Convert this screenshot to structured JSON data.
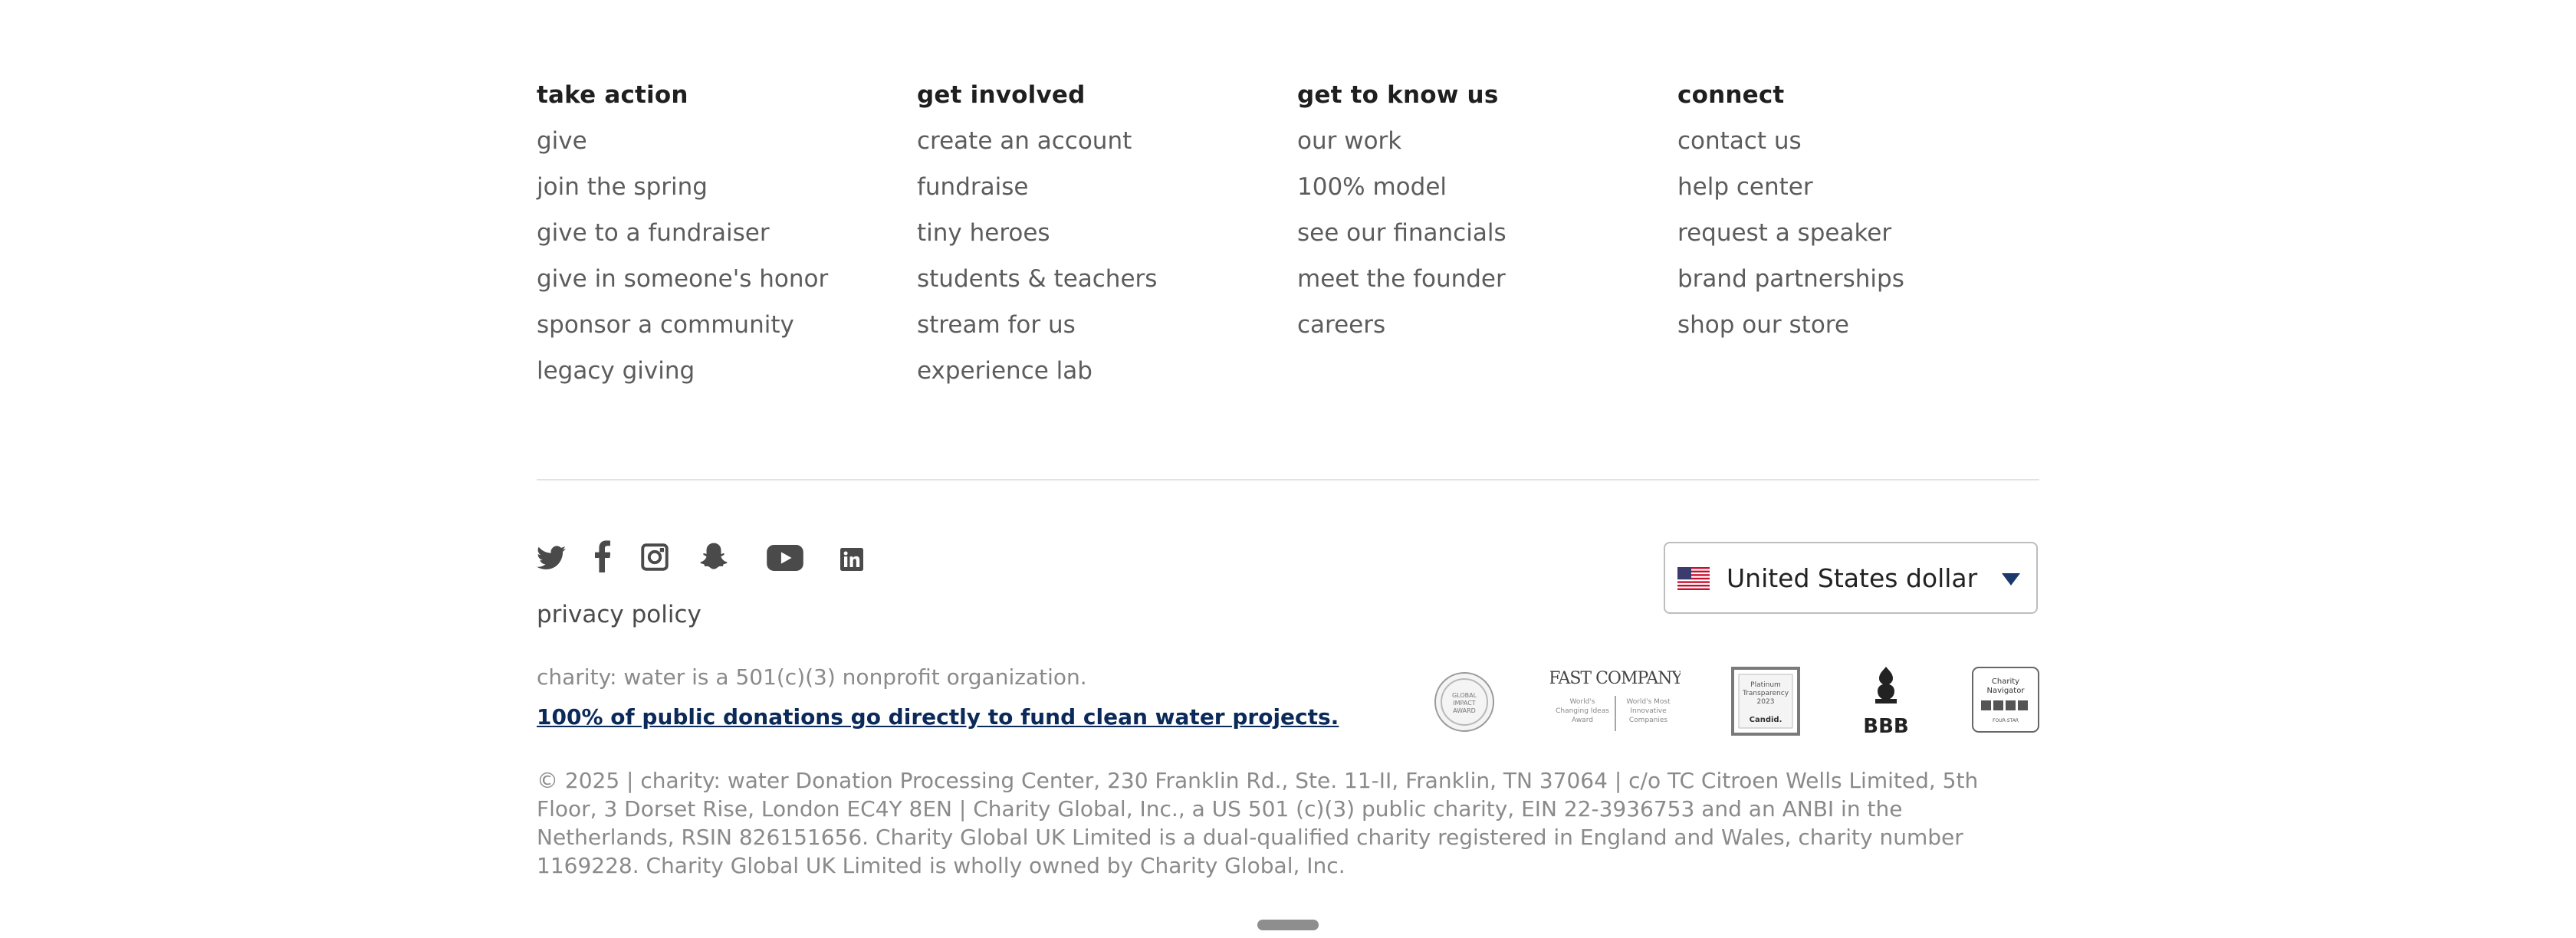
{
  "footer": {
    "columns": [
      {
        "heading": "take action",
        "items": [
          "give",
          "join the spring",
          "give to a fundraiser",
          "give in someone's honor",
          "sponsor a community",
          "legacy giving"
        ]
      },
      {
        "heading": "get involved",
        "items": [
          "create an account",
          "fundraise",
          "tiny heroes",
          "students & teachers",
          "stream for us",
          "experience lab"
        ]
      },
      {
        "heading": "get to know us",
        "items": [
          "our work",
          "100% model",
          "see our financials",
          "meet the founder",
          "careers"
        ]
      },
      {
        "heading": "connect",
        "items": [
          "contact us",
          "help center",
          "request a speaker",
          "brand partnerships",
          "shop our store"
        ]
      }
    ],
    "social_icons": [
      "twitter-icon",
      "facebook-icon",
      "instagram-icon",
      "snapchat-icon",
      "youtube-icon",
      "linkedin-icon"
    ],
    "privacy_policy": "privacy policy",
    "currency": {
      "selected": "United States dollar",
      "flag_icon": "us-flag-icon"
    },
    "nonprofit_text": "charity: water is a 501(c)(3) nonprofit organization.",
    "donations_link": "100% of public donations go directly to fund clean water projects.",
    "badges": {
      "global_impact": {
        "lines": [
          "GLOBAL",
          "IMPACT",
          "AWARD"
        ]
      },
      "fast_company": {
        "logo": "FAST COMPANY",
        "left_caption": [
          "World's",
          "Changing Ideas",
          "Award"
        ],
        "right_caption": [
          "World's Most",
          "Innovative",
          "Companies"
        ]
      },
      "candid": {
        "lines": [
          "Platinum",
          "Transparency",
          "2023"
        ],
        "brand": "Candid."
      },
      "bbb": {
        "label": "BBB"
      },
      "charity_navigator": {
        "lines": [
          "Charity",
          "Navigator"
        ],
        "rating": "FOUR-STAR"
      }
    },
    "legal": "© 2025 | charity: water Donation Processing Center, 230 Franklin Rd., Ste. 11-II, Franklin, TN 37064 | c/o TC Citroen Wells Limited, 5th Floor, 3 Dorset Rise, London EC4Y 8EN | Charity Global, Inc., a US 501 (c)(3) public charity, EIN 22-3936753 and an ANBI in the Netherlands, RSIN 826151656. Charity Global UK Limited is a dual-qualified charity registered in England and Wales, charity number 1169228. Charity Global UK Limited is wholly owned by Charity Global, Inc.",
    "colors": {
      "heading": "#1f1f1f",
      "link": "#5c5c5c",
      "muted": "#8a8a8a",
      "accent": "#0b2a5a",
      "divider": "#e2e2e2"
    }
  }
}
